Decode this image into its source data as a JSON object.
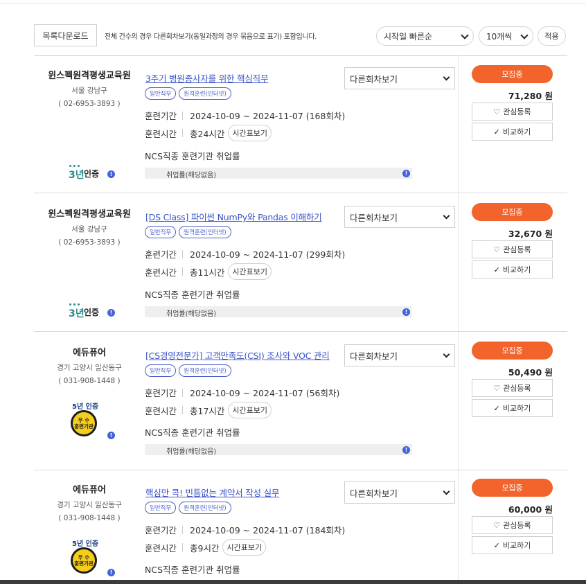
{
  "toolbar": {
    "download_label": "목록다운로드",
    "note": "전체 건수의 경우 다른회차보기(동일과정의 경우 묶음으로 표기) 포함입니다.",
    "sort_value": "시작일 빠른순",
    "count_value": "10개씩",
    "apply_label": "적용"
  },
  "labels": {
    "other_rounds": "다른회차보기",
    "period_key": "훈련기간",
    "hours_key": "훈련시간",
    "timetable": "시간표보기",
    "ncs": "NCS직종 훈련기관 취업률",
    "employment_rate": "취업률(해당없음)",
    "wish": "관심등록",
    "compare": "비교하기",
    "cert_3_digit": "3년",
    "cert_3_label": "인증",
    "cert_5_label": "5년 인증",
    "seal_line1": "우 수",
    "seal_line2": "훈련기관"
  },
  "courses": [
    {
      "institution": "윈스펙원격평생교육원",
      "address": "서울 강남구",
      "phone": "( 02-6953-3893 )",
      "cert": "3",
      "title": "3주기 병원종사자를 위한 핵심직무",
      "tags": [
        "일반직무",
        "원격훈련(인터넷)"
      ],
      "period": "2024-10-09 ~ 2024-11-07 (168회차)",
      "hours": "총24시간",
      "status": "모집중",
      "price": "71,280 원"
    },
    {
      "institution": "윈스펙원격평생교육원",
      "address": "서울 강남구",
      "phone": "( 02-6953-3893 )",
      "cert": "3",
      "title": "[DS Class] 파이썬 NumPy와 Pandas 이해하기",
      "tags": [
        "일반직무",
        "원격훈련(인터넷)"
      ],
      "period": "2024-10-09 ~ 2024-11-07 (299회차)",
      "hours": "총11시간",
      "status": "모집중",
      "price": "32,670 원"
    },
    {
      "institution": "에듀퓨어",
      "address": "경기 고양시 일산동구",
      "phone": "( 031-908-1448 )",
      "cert": "5",
      "title": "[CS경영전문가] 고객만족도(CSI) 조사와 VOC 관리",
      "tags": [
        "일반직무",
        "원격훈련(인터넷)"
      ],
      "period": "2024-10-09 ~ 2024-11-07 (56회차)",
      "hours": "총17시간",
      "status": "모집중",
      "price": "50,490 원"
    },
    {
      "institution": "에듀퓨어",
      "address": "경기 고양시 일산동구",
      "phone": "( 031-908-1448 )",
      "cert": "5",
      "title": "핵심만 콕! 빈틈없는 계약서 작성 실무",
      "tags": [
        "일반직무",
        "원격훈련(인터넷)"
      ],
      "period": "2024-10-09 ~ 2024-11-07 (184회차)",
      "hours": "총9시간",
      "status": "모집중",
      "price": "60,000 원"
    }
  ],
  "colors": {
    "accent": "#f2642c",
    "link": "#3a53c7",
    "tag": "#4a5fc8",
    "info": "#4463d6"
  }
}
